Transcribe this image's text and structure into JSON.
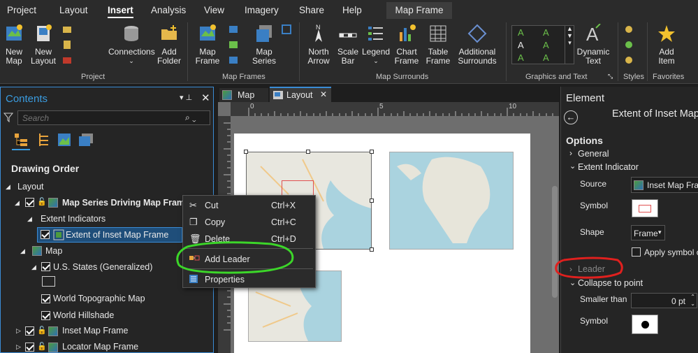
{
  "menubar": {
    "tabs": [
      "Project",
      "Layout",
      "Insert",
      "Analysis",
      "View",
      "Imagery",
      "Share",
      "Help"
    ],
    "active_tab": "Insert",
    "contextual_tab": "Map Frame"
  },
  "ribbon": {
    "project_group": {
      "label": "Project",
      "new_map": "New\nMap",
      "new_layout": "New\nLayout",
      "connections": "Connections",
      "add_folder": "Add\nFolder"
    },
    "map_frames_group": {
      "label": "Map Frames",
      "map_frame": "Map\nFrame",
      "map_series": "Map\nSeries"
    },
    "surrounds_group": {
      "label": "Map Surrounds",
      "north_arrow": "North\nArrow",
      "scale_bar": "Scale\nBar",
      "legend": "Legend",
      "chart_frame": "Chart\nFrame",
      "table_frame": "Table\nFrame",
      "additional": "Additional\nSurrounds"
    },
    "graphics_group": {
      "label": "Graphics and Text",
      "dynamic_text": "Dynamic\nText"
    },
    "styles_group": {
      "label": "Styles"
    },
    "favorites_group": {
      "label": "Favorites",
      "add_item": "Add\nItem"
    },
    "scale_ticks": "0  5  10"
  },
  "contents": {
    "title": "Contents",
    "search_placeholder": "Search",
    "drawing_order_heading": "Drawing Order",
    "layout_label": "Layout",
    "items": {
      "map_series_frame": "Map Series Driving Map Frame",
      "extent_indicators": "Extent Indicators",
      "extent_of_inset": "Extent of Inset Map Frame",
      "map": "Map",
      "us_states": "U.S. States (Generalized)",
      "world_topo": "World Topographic Map",
      "world_hillshade": "World Hillshade",
      "inset_map_frame": "Inset Map Frame",
      "locator_map_frame": "Locator Map Frame"
    }
  },
  "context_menu": {
    "items": [
      {
        "label": "Cut",
        "shortcut": "Ctrl+X"
      },
      {
        "label": "Copy",
        "shortcut": "Ctrl+C"
      },
      {
        "label": "Delete",
        "shortcut": "Ctrl+D"
      },
      {
        "label": "Add Leader",
        "shortcut": ""
      },
      {
        "label": "Properties",
        "shortcut": ""
      }
    ]
  },
  "view_tabs": {
    "map": "Map",
    "layout": "Layout"
  },
  "ruler": {
    "t0": "0",
    "t5": "5",
    "t10": "10"
  },
  "element_pane": {
    "title": "Element",
    "subtitle": "Extent of Inset Map",
    "options": "Options",
    "general": "General",
    "extent_indicator": "Extent Indicator",
    "source_label": "Source",
    "source_value": "Inset Map Fram",
    "symbol_label": "Symbol",
    "shape_label": "Shape",
    "shape_value": "Frame",
    "apply_symbol": "Apply symbol c",
    "leader": "Leader",
    "collapse_to_point": "Collapse to point",
    "smaller_than_label": "Smaller than",
    "smaller_than_value": "0 pt",
    "symbol2_label": "Symbol"
  },
  "colors": {
    "accent": "#3a8cd6",
    "highlight_green": "#3cd629",
    "highlight_red": "#e0201e",
    "selection": "#1f4e7a"
  }
}
